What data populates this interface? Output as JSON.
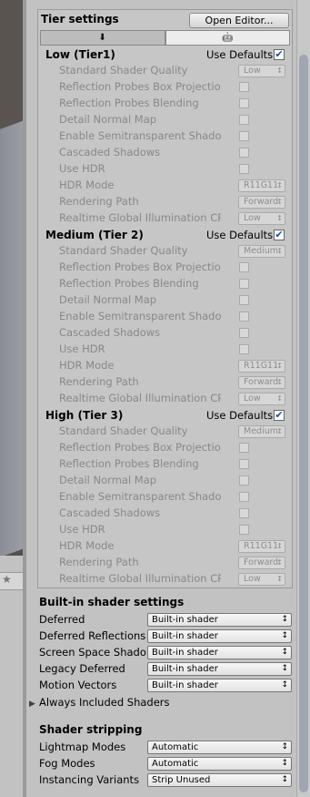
{
  "tier_settings": {
    "title": "Tier settings",
    "open_editor_label": "Open Editor...",
    "platform_tabs": [
      {
        "icon": "download-arrow-icon",
        "glyph": "⬇"
      },
      {
        "icon": "android-icon",
        "glyph": "🤖"
      }
    ],
    "use_defaults_label": "Use Defaults",
    "tiers": [
      {
        "name": "Low (Tier1)",
        "use_defaults": true,
        "settings": {
          "standard_shader_quality": {
            "label": "Standard Shader Quality",
            "value": "Low"
          },
          "reflection_probes_box_projection": {
            "label": "Reflection Probes Box Projection"
          },
          "reflection_probes_blending": {
            "label": "Reflection Probes Blending"
          },
          "detail_normal_map": {
            "label": "Detail Normal Map"
          },
          "enable_semitransparent_shadows": {
            "label": "Enable Semitransparent Shadows"
          },
          "cascaded_shadows": {
            "label": "Cascaded Shadows"
          },
          "use_hdr": {
            "label": "Use HDR"
          },
          "hdr_mode": {
            "label": "HDR Mode",
            "value": "R11G11"
          },
          "rendering_path": {
            "label": "Rendering Path",
            "value": "Forward"
          },
          "realtime_gi_cpu_usage": {
            "label": "Realtime Global Illumination CPU Usage",
            "value": "Low"
          }
        }
      },
      {
        "name": "Medium (Tier 2)",
        "use_defaults": true,
        "settings": {
          "standard_shader_quality": {
            "label": "Standard Shader Quality",
            "value": "Medium"
          },
          "reflection_probes_box_projection": {
            "label": "Reflection Probes Box Projection"
          },
          "reflection_probes_blending": {
            "label": "Reflection Probes Blending"
          },
          "detail_normal_map": {
            "label": "Detail Normal Map"
          },
          "enable_semitransparent_shadows": {
            "label": "Enable Semitransparent Shadows"
          },
          "cascaded_shadows": {
            "label": "Cascaded Shadows"
          },
          "use_hdr": {
            "label": "Use HDR"
          },
          "hdr_mode": {
            "label": "HDR Mode",
            "value": "R11G11"
          },
          "rendering_path": {
            "label": "Rendering Path",
            "value": "Forward"
          },
          "realtime_gi_cpu_usage": {
            "label": "Realtime Global Illumination CPU Usage",
            "value": "Low"
          }
        }
      },
      {
        "name": "High (Tier 3)",
        "use_defaults": true,
        "settings": {
          "standard_shader_quality": {
            "label": "Standard Shader Quality",
            "value": "Medium"
          },
          "reflection_probes_box_projection": {
            "label": "Reflection Probes Box Projection"
          },
          "reflection_probes_blending": {
            "label": "Reflection Probes Blending"
          },
          "detail_normal_map": {
            "label": "Detail Normal Map"
          },
          "enable_semitransparent_shadows": {
            "label": "Enable Semitransparent Shadows"
          },
          "cascaded_shadows": {
            "label": "Cascaded Shadows"
          },
          "use_hdr": {
            "label": "Use HDR"
          },
          "hdr_mode": {
            "label": "HDR Mode",
            "value": "R11G11"
          },
          "rendering_path": {
            "label": "Rendering Path",
            "value": "Forward"
          },
          "realtime_gi_cpu_usage": {
            "label": "Realtime Global Illumination CPU Usage",
            "value": "Low"
          }
        }
      }
    ]
  },
  "builtin_shader_settings": {
    "title": "Built-in shader settings",
    "fields": [
      {
        "label": "Deferred",
        "value": "Built-in shader"
      },
      {
        "label": "Deferred Reflections",
        "value": "Built-in shader"
      },
      {
        "label": "Screen Space Shadows",
        "value": "Built-in shader"
      },
      {
        "label": "Legacy Deferred",
        "value": "Built-in shader"
      },
      {
        "label": "Motion Vectors",
        "value": "Built-in shader"
      }
    ],
    "always_included_label": "Always Included Shaders"
  },
  "shader_stripping": {
    "title": "Shader stripping",
    "fields": [
      {
        "label": "Lightmap Modes",
        "value": "Automatic"
      },
      {
        "label": "Fog Modes",
        "value": "Automatic"
      },
      {
        "label": "Instancing Variants",
        "value": "Strip Unused"
      }
    ]
  },
  "scene_toolbar": {
    "star_icon": "star-icon",
    "star_glyph": "★"
  }
}
